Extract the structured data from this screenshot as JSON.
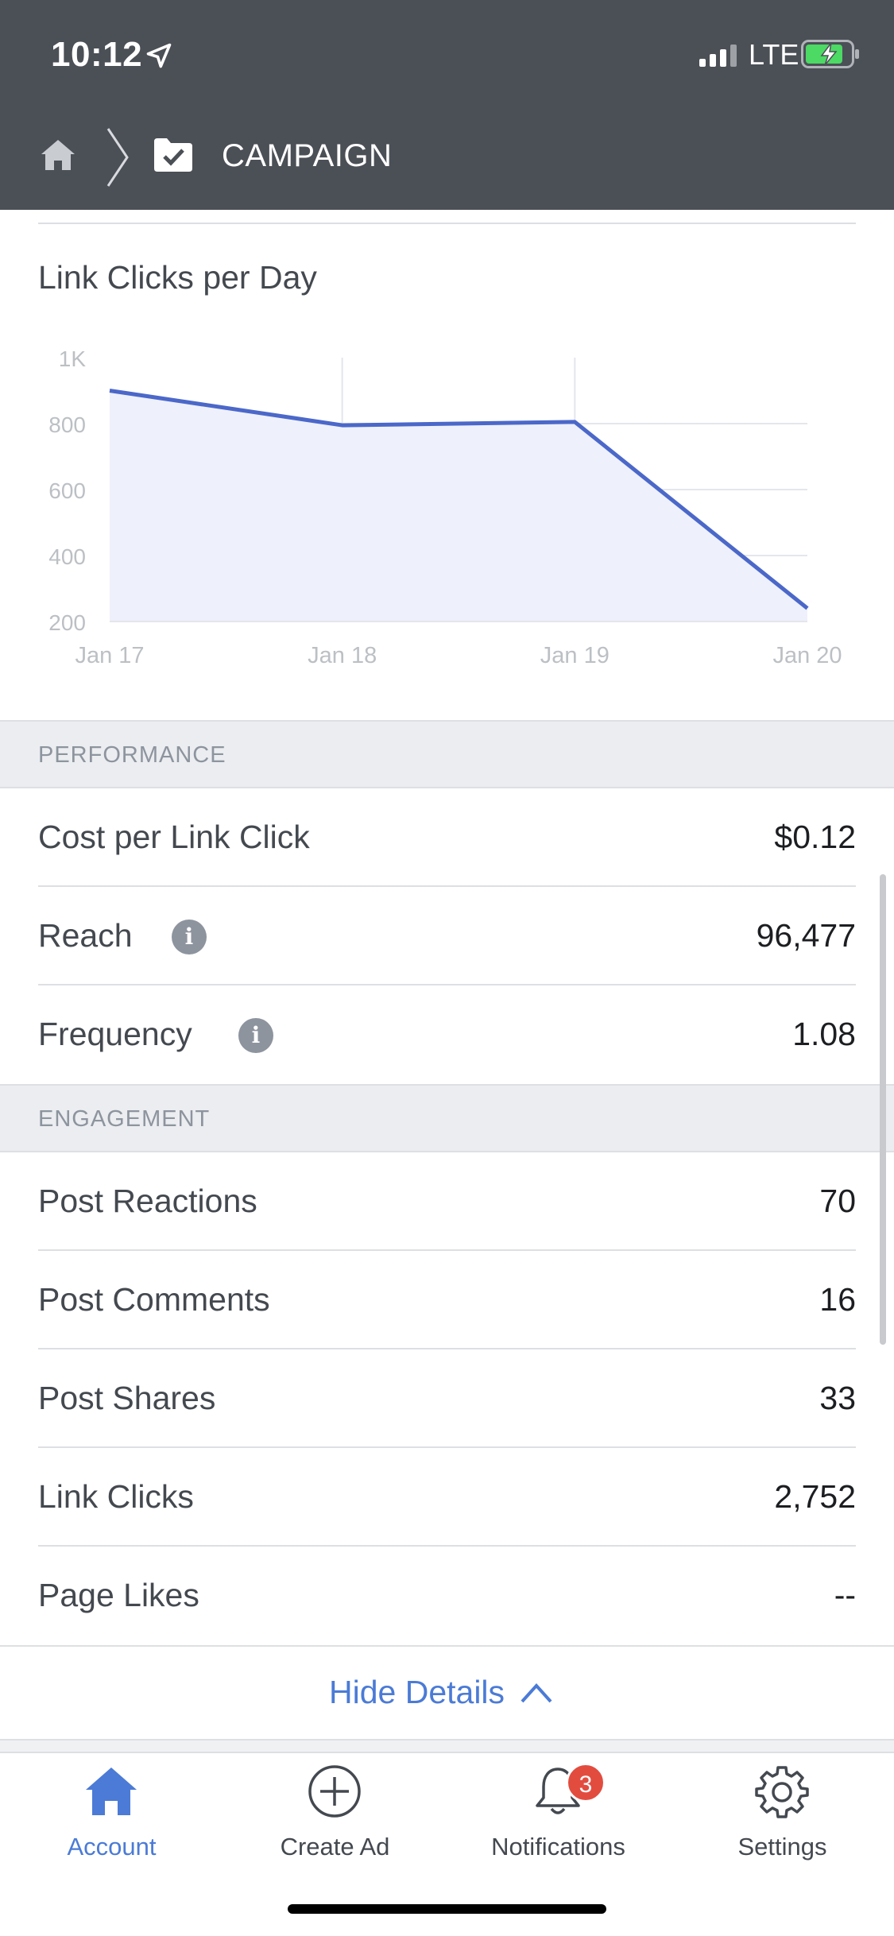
{
  "status_bar": {
    "time": "10:12",
    "network": "LTE"
  },
  "header": {
    "title": "CAMPAIGN"
  },
  "chart_data": {
    "type": "area",
    "title": "Link Clicks per Day",
    "categories": [
      "Jan 17",
      "Jan 18",
      "Jan 19",
      "Jan 20"
    ],
    "values": [
      900,
      795,
      805,
      240
    ],
    "y_ticks": [
      "1K",
      "800",
      "600",
      "400",
      "200"
    ],
    "ylim": [
      200,
      1000
    ],
    "grid": true,
    "colors": {
      "line": "#4b68c9",
      "fill": "#eef0fb",
      "grid": "#e4e6eb",
      "tick": "#bcc0c4"
    }
  },
  "performance": {
    "section_label": "PERFORMANCE",
    "rows": [
      {
        "label": "Cost per Link Click",
        "value": "$0.12"
      },
      {
        "label": "Reach",
        "value": "96,477",
        "info": "i"
      },
      {
        "label": "Frequency",
        "value": "1.08",
        "info": "i"
      }
    ]
  },
  "engagement": {
    "section_label": "ENGAGEMENT",
    "rows": [
      {
        "label": "Post Reactions",
        "value": "70"
      },
      {
        "label": "Post Comments",
        "value": "16"
      },
      {
        "label": "Post Shares",
        "value": "33"
      },
      {
        "label": "Link Clicks",
        "value": "2,752"
      },
      {
        "label": "Page Likes",
        "value": "--"
      }
    ]
  },
  "hide_details": {
    "label": "Hide Details"
  },
  "tabbar": {
    "tabs": [
      {
        "label": "Account",
        "icon": "home-icon",
        "active": true
      },
      {
        "label": "Create Ad",
        "icon": "plus-circle-icon"
      },
      {
        "label": "Notifications",
        "icon": "bell-icon",
        "badge": "3"
      },
      {
        "label": "Settings",
        "icon": "gear-icon"
      }
    ]
  },
  "colors": {
    "accent": "#4b7bd6",
    "header_bg": "#4b4f56",
    "badge": "#e24c3f"
  }
}
